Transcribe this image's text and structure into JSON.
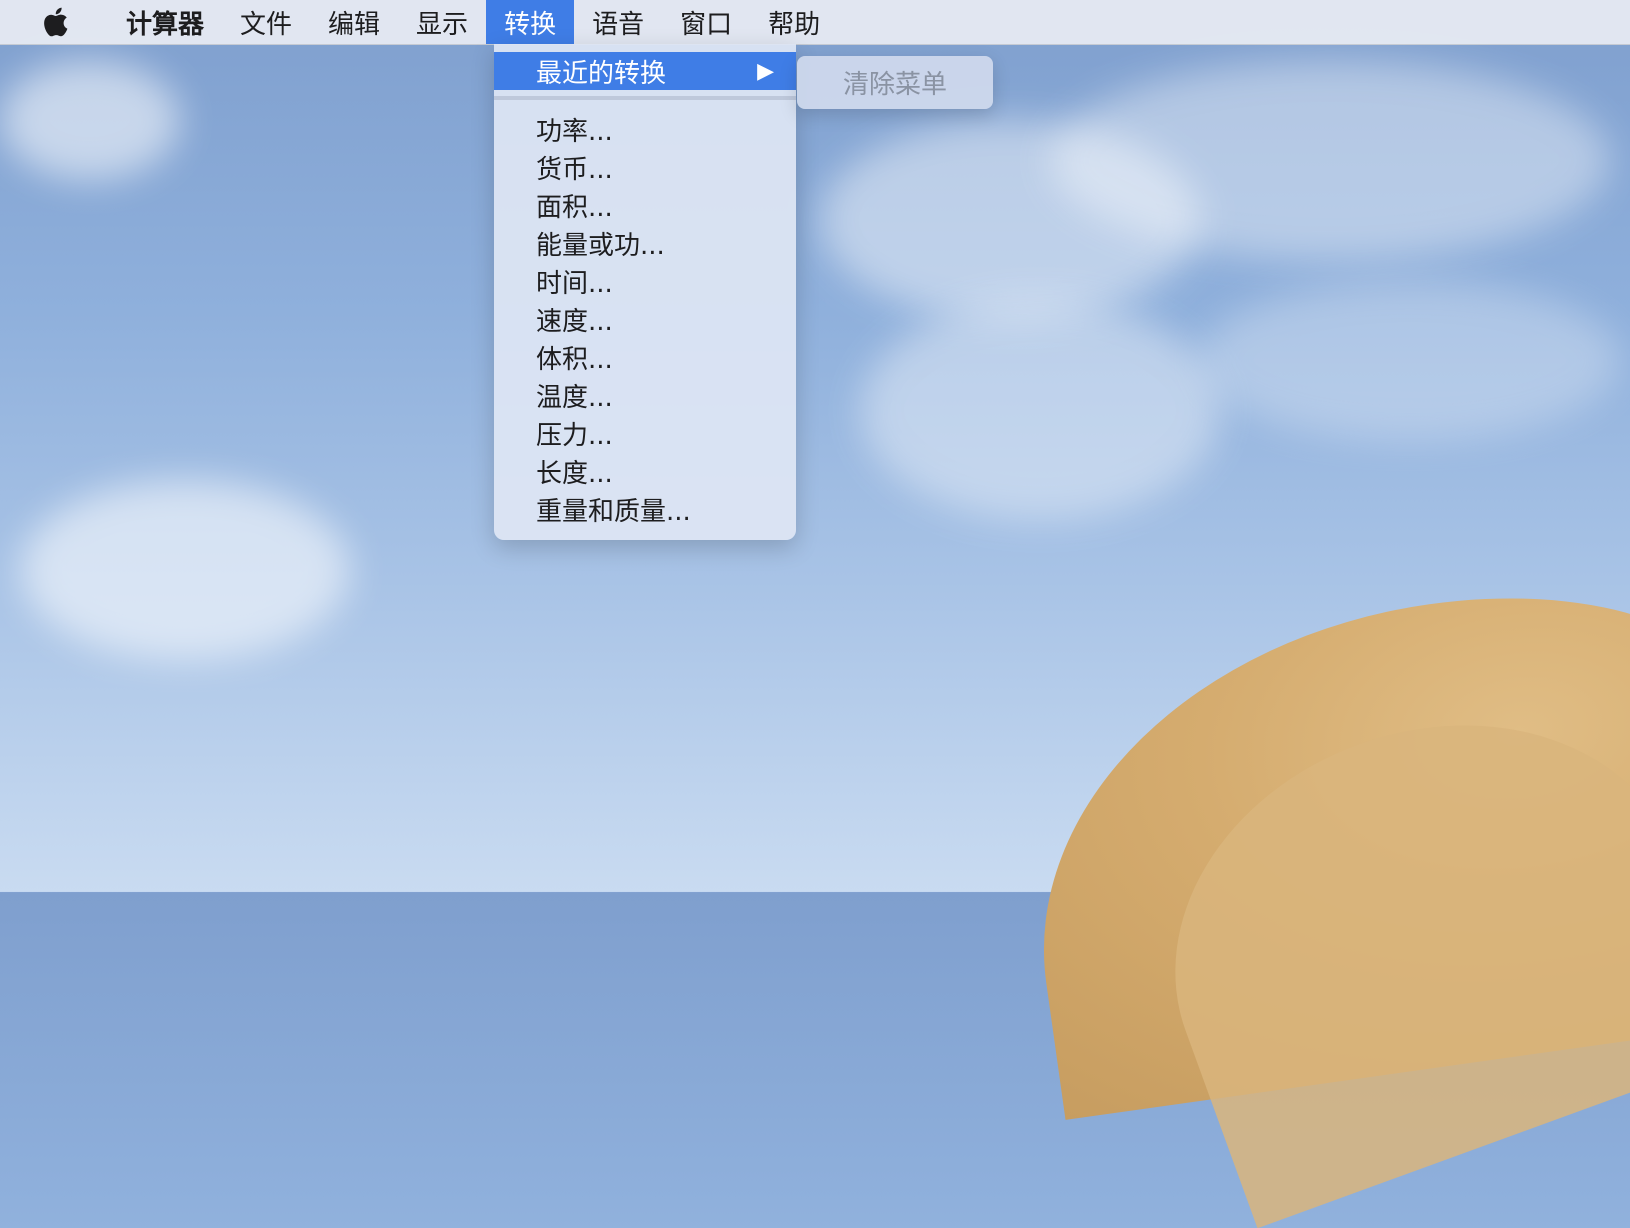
{
  "menubar": {
    "apple_icon": "apple-logo-icon",
    "items": [
      {
        "label": "计算器"
      },
      {
        "label": "文件"
      },
      {
        "label": "编辑"
      },
      {
        "label": "显示"
      },
      {
        "label": "转换"
      },
      {
        "label": "语音"
      },
      {
        "label": "窗口"
      },
      {
        "label": "帮助"
      }
    ]
  },
  "dropdown": {
    "highlighted": {
      "label": "最近的转换",
      "arrow": "▶"
    },
    "items": [
      {
        "label": "功率..."
      },
      {
        "label": "货币..."
      },
      {
        "label": "面积..."
      },
      {
        "label": "能量或功..."
      },
      {
        "label": "时间..."
      },
      {
        "label": "速度..."
      },
      {
        "label": "体积..."
      },
      {
        "label": "温度..."
      },
      {
        "label": "压力..."
      },
      {
        "label": "长度..."
      },
      {
        "label": "重量和质量..."
      }
    ]
  },
  "submenu": {
    "clear_label": "清除菜单"
  },
  "colors": {
    "highlight": "#3f7de6",
    "menubar_bg": "#e8ecf3",
    "disabled_text": "#8a93a3"
  }
}
